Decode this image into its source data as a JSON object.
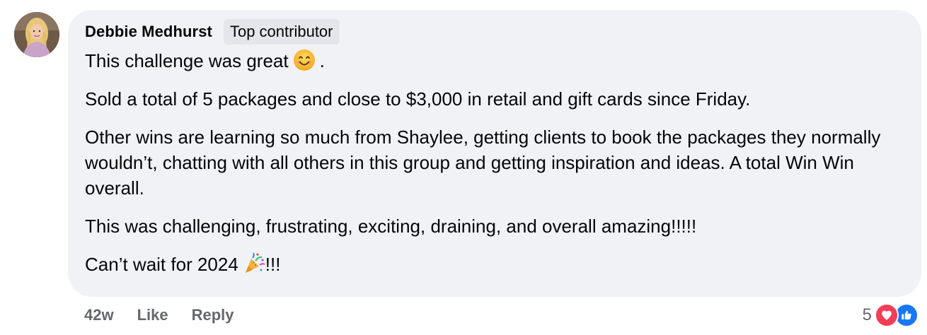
{
  "comment": {
    "author": "Debbie Medhurst",
    "badge": "Top contributor",
    "avatar_icon": "avatar-photo",
    "lines": {
      "line1_text": "This challenge was great",
      "line1_suffix": ".",
      "line2": "Sold a total of 5 packages and close to $3,000 in retail and gift cards since Friday.",
      "line3": "Other wins are learning so much from Shaylee, getting clients to book the packages they normally wouldn’t, chatting with all others in this group and getting inspiration and ideas. A total Win Win overall.",
      "line4": "This was challenging, frustrating, exciting, draining, and overall amazing!!!!!",
      "line5_text": "Can’t wait for 2024",
      "line5_suffix": "!!!"
    },
    "emojis": [
      "smiling-face-emoji",
      "party-popper-emoji"
    ]
  },
  "actions": {
    "time": "42w",
    "like_label": "Like",
    "reply_label": "Reply"
  },
  "reactions": {
    "count": "5",
    "icons": [
      "love-reaction-icon",
      "like-reaction-icon"
    ]
  },
  "colors": {
    "bubble_bg": "#f0f2f5",
    "badge_bg": "#e4e6eb",
    "secondary_text": "#65676b",
    "love": "#f33e58",
    "like": "#1877f2"
  }
}
